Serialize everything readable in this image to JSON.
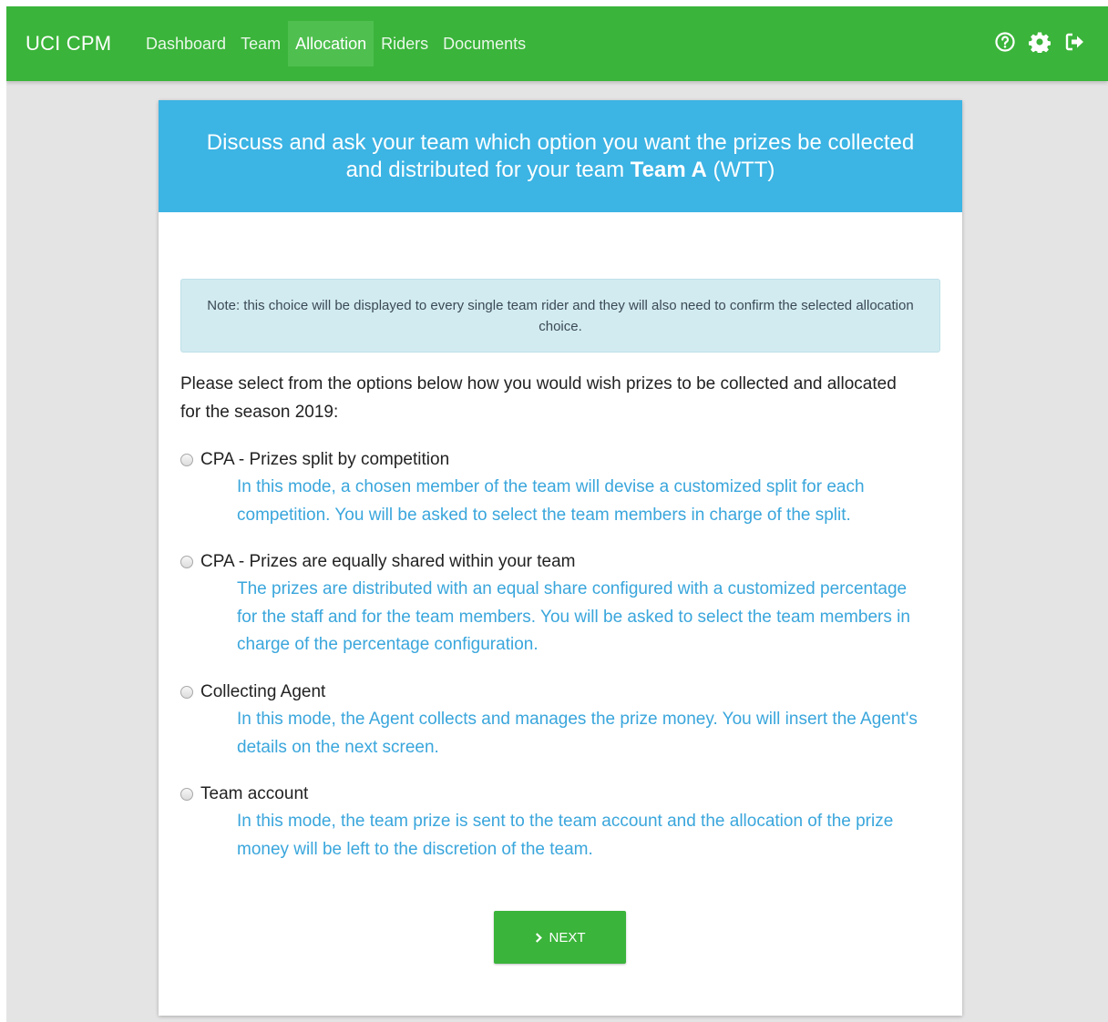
{
  "app": {
    "brand": "UCI CPM"
  },
  "nav": {
    "items": [
      {
        "label": "Dashboard"
      },
      {
        "label": "Team"
      },
      {
        "label": "Allocation"
      },
      {
        "label": "Riders"
      },
      {
        "label": "Documents"
      }
    ],
    "active": "Allocation",
    "icons": [
      "help-circle-icon",
      "gear-icon",
      "logout-icon"
    ]
  },
  "header": {
    "line1": "Discuss and ask your team which option you want the prizes be collected",
    "line2_prefix": "and distributed for your team ",
    "team_name": "Team A",
    "team_suffix": " (WTT)"
  },
  "note": {
    "text": "Note: this choice will be displayed to every single team rider and they will also need to confirm the selected allocation choice."
  },
  "intro": {
    "text": "Please select from the options below how you would wish prizes to be collected and allocated for the season 2019:"
  },
  "options": [
    {
      "label": "CPA - Prizes split by competition",
      "description": "In this mode, a chosen member of the team will devise a customized split for each competition. You will be asked to select the team members in charge of the split.",
      "selected": false
    },
    {
      "label": "CPA - Prizes are equally shared within your team",
      "description": "The prizes are distributed with an equal share configured with a customized percentage for the staff and for the team members. You will be asked to select the team members in charge of the percentage configuration.",
      "selected": false
    },
    {
      "label": "Collecting Agent",
      "description": "In this mode, the Agent collects and manages the prize money. You will insert the Agent's details on the next screen.",
      "selected": false
    },
    {
      "label": "Team account",
      "description": "In this mode, the team prize is sent to the team account and the allocation of the prize money will be left to the discretion of the team.",
      "selected": false
    }
  ],
  "actions": {
    "next_label": "NEXT",
    "next_icon": "chevron-right-icon"
  },
  "colors": {
    "nav": "#3ab43a",
    "header": "#3cb4e4",
    "note_bg": "#d2ebf1",
    "description": "#3aa6dc",
    "background": "#e5e4e5"
  }
}
